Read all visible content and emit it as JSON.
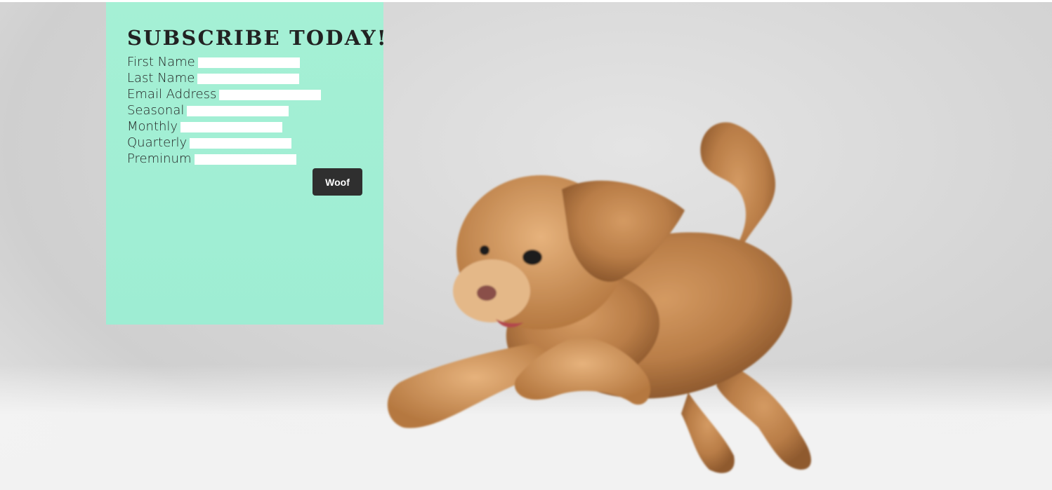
{
  "form": {
    "title": "SUBSCRIBE TODAY!",
    "fields": [
      {
        "label": "First Name",
        "value": ""
      },
      {
        "label": "Last Name",
        "value": ""
      },
      {
        "label": "Email Address",
        "value": ""
      },
      {
        "label": "Seasonal",
        "value": ""
      },
      {
        "label": "Monthly",
        "value": ""
      },
      {
        "label": "Quarterly",
        "value": ""
      },
      {
        "label": "Preminum",
        "value": ""
      }
    ],
    "submit_label": "Woof"
  },
  "colors": {
    "panel": "#a5f0d5",
    "button": "#2f2f2f",
    "dog_fur": "#c08a55",
    "backdrop": "#d6d6d6"
  },
  "hero": {
    "image_subject": "jumping-dog-photo"
  }
}
